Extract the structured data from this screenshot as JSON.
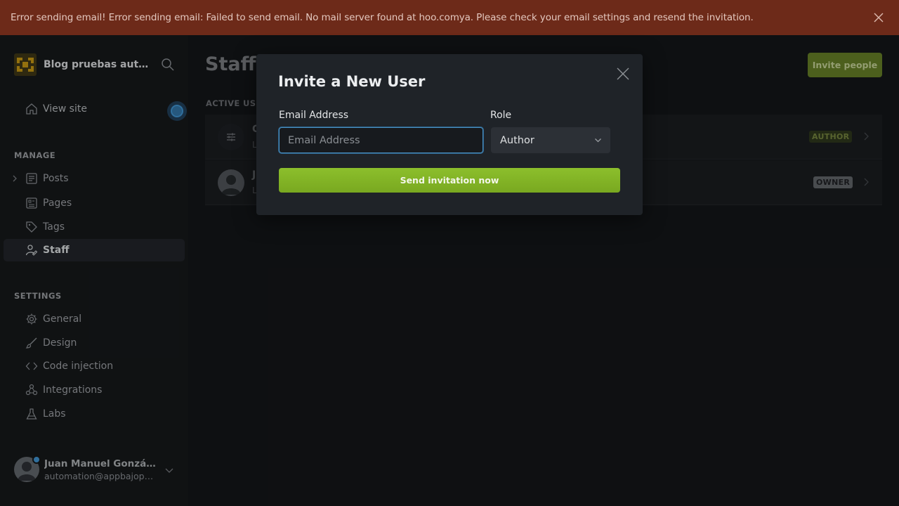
{
  "banner": {
    "message": "Error sending email! Error sending email: Failed to send email. No mail server found at hoo.comya. Please check your email settings and resend the invitation.",
    "close_icon": "close-icon"
  },
  "sidebar": {
    "site_title": "Blog pruebas auto...",
    "view_site": "View site",
    "manage_title": "MANAGE",
    "settings_title": "SETTINGS",
    "manage_items": [
      {
        "label": "Posts",
        "icon": "posts-icon"
      },
      {
        "label": "Pages",
        "icon": "pages-icon"
      },
      {
        "label": "Tags",
        "icon": "tag-icon"
      },
      {
        "label": "Staff",
        "icon": "staff-icon",
        "active": true
      }
    ],
    "settings_items": [
      {
        "label": "General",
        "icon": "gear-icon"
      },
      {
        "label": "Design",
        "icon": "brush-icon"
      },
      {
        "label": "Code injection",
        "icon": "code-icon"
      },
      {
        "label": "Integrations",
        "icon": "integrations-icon"
      },
      {
        "label": "Labs",
        "icon": "flask-icon"
      }
    ],
    "user": {
      "name": "Juan Manuel Gonzále...",
      "email": "automation@appbajopru..."
    }
  },
  "main": {
    "title": "Staff",
    "invite_button": "Invite people",
    "section_label": "ACTIVE USE",
    "rows": [
      {
        "letter": "C",
        "sub": "L",
        "role": "AUTHOR"
      },
      {
        "letter": "J",
        "sub": "L",
        "role": "OWNER"
      }
    ]
  },
  "modal": {
    "title": "Invite a New User",
    "email_label": "Email Address",
    "email_placeholder": "Email Address",
    "email_value": "",
    "role_label": "Role",
    "role_value": "Author",
    "send_button": "Send invitation now"
  },
  "colors": {
    "banner_bg": "#6d2a19",
    "accent_green": "#8cbf2c",
    "focus_blue": "#4a90c2"
  }
}
